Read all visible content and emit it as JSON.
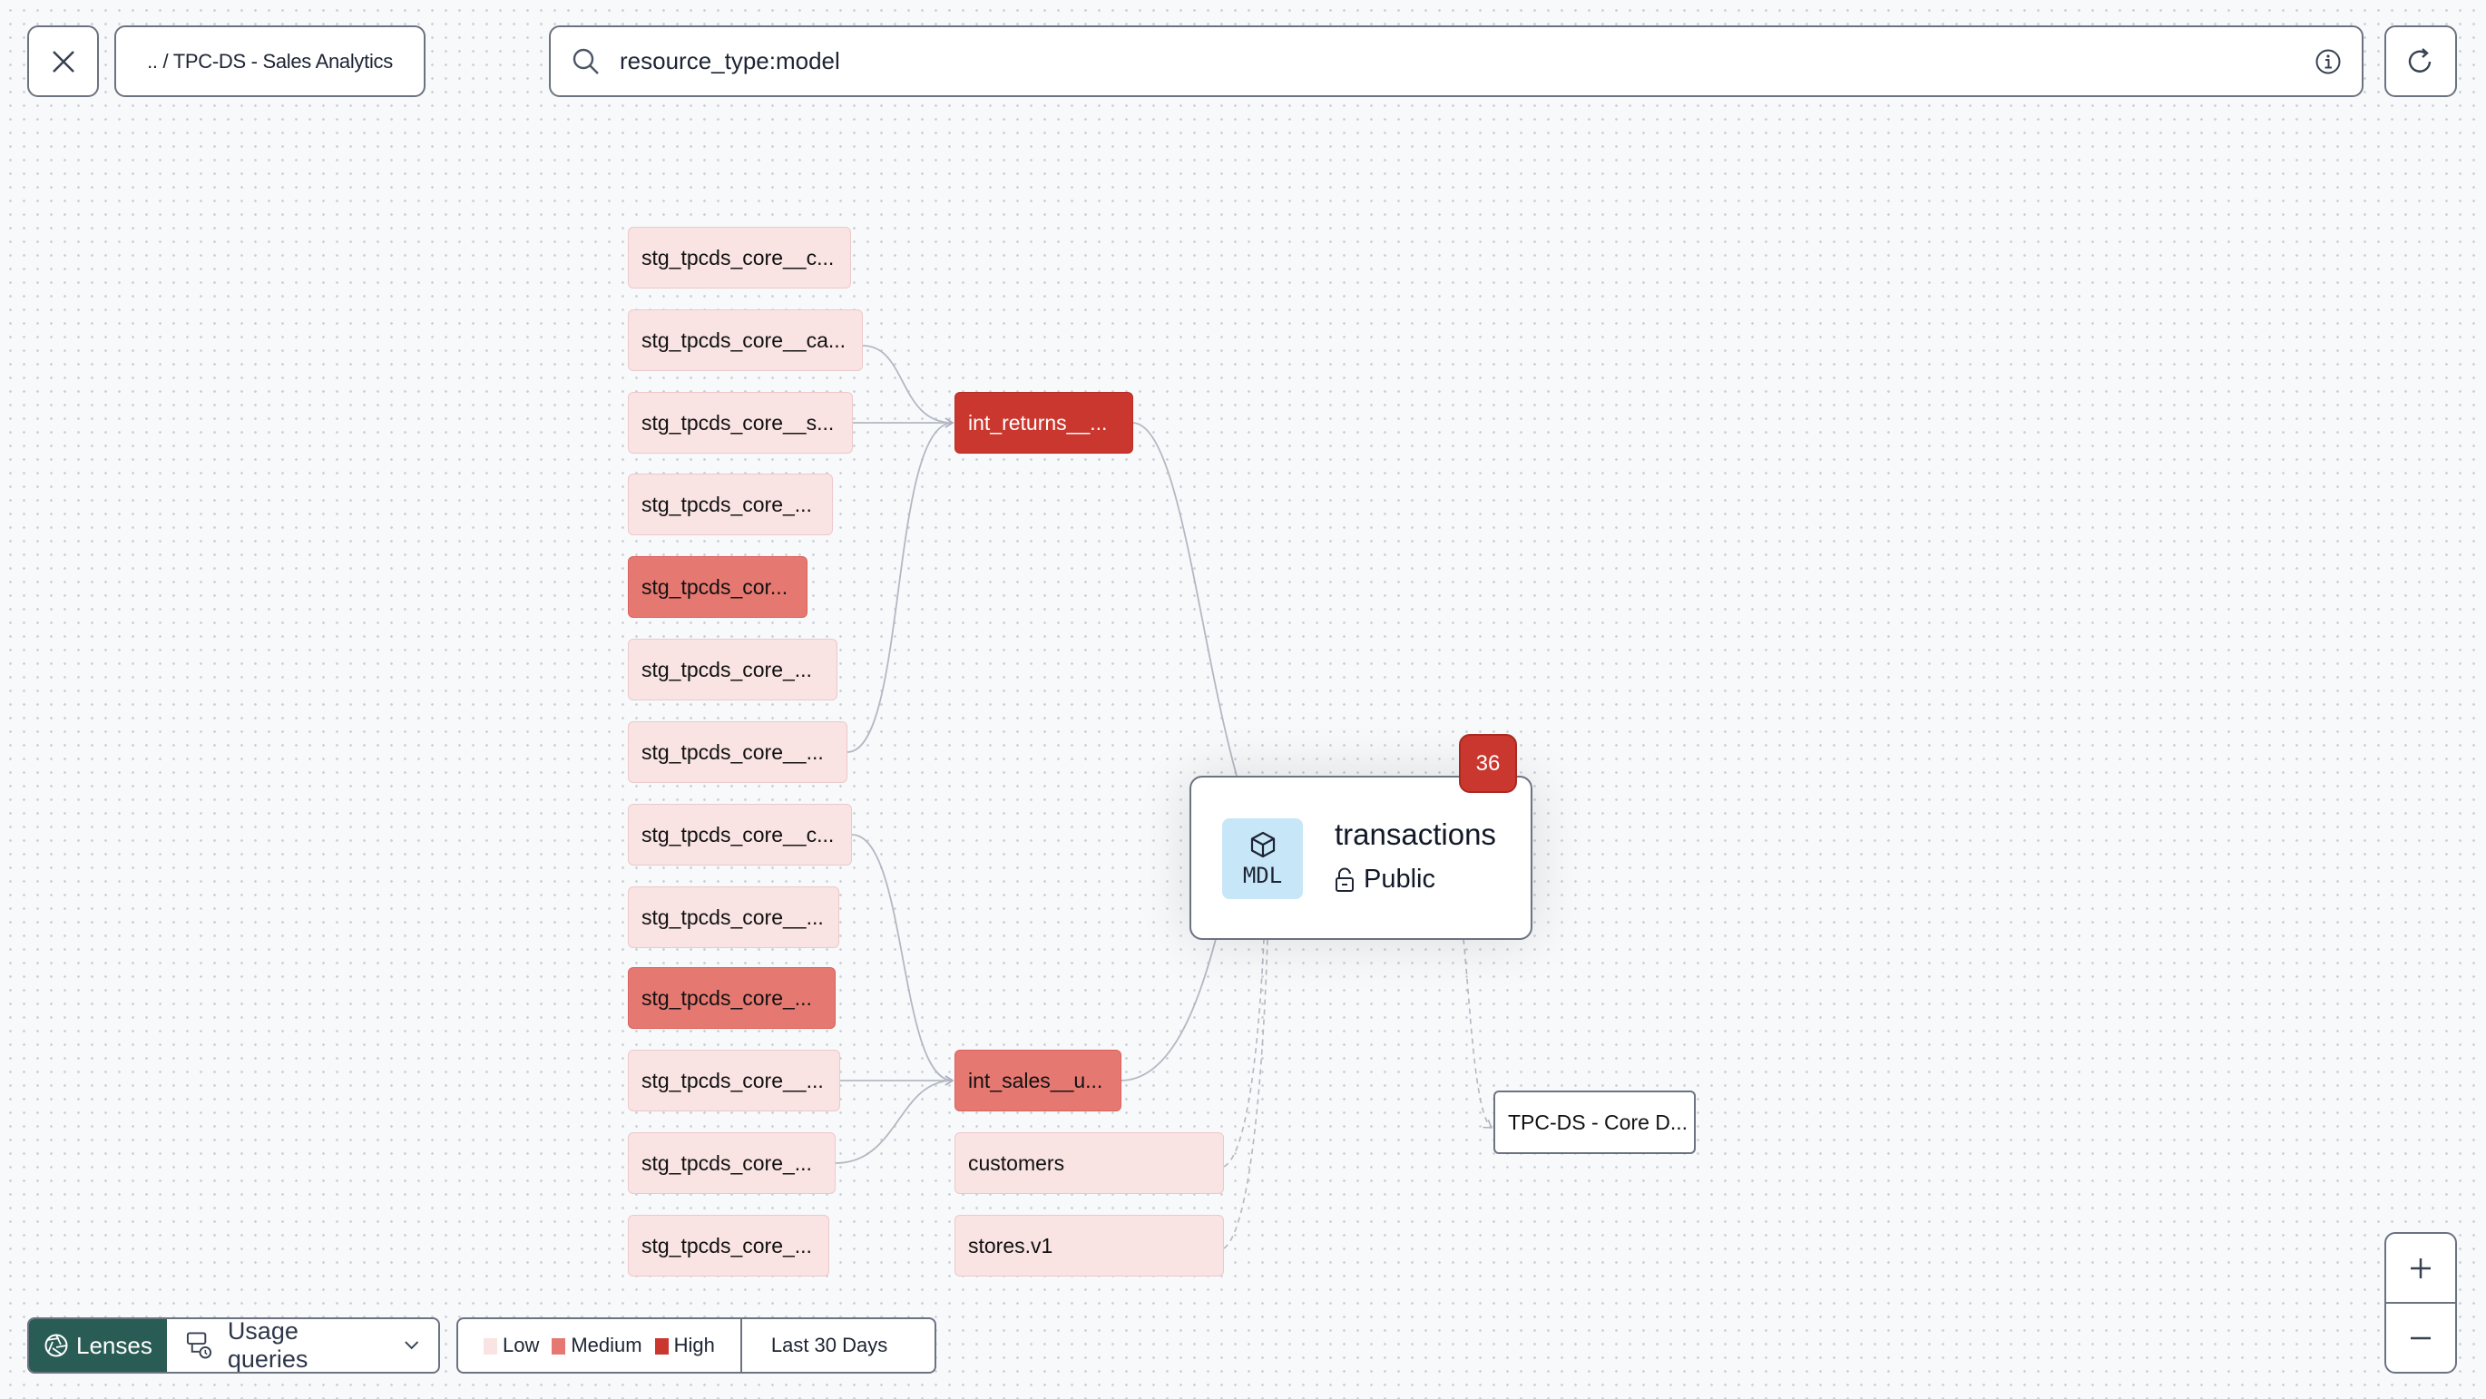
{
  "header": {
    "close_icon": "close-icon",
    "breadcrumb": ".. / TPC-DS - Sales Analytics",
    "search": {
      "value": "resource_type:model",
      "icon": "search-icon",
      "info_icon": "info-icon"
    },
    "refresh_icon": "refresh-icon"
  },
  "graph": {
    "upstream_staging": [
      {
        "label": "stg_tpcds_core__c...",
        "usage": "low"
      },
      {
        "label": "stg_tpcds_core__ca...",
        "usage": "low"
      },
      {
        "label": "stg_tpcds_core__s...",
        "usage": "low"
      },
      {
        "label": "stg_tpcds_core_...",
        "usage": "low"
      },
      {
        "label": "stg_tpcds_cor...",
        "usage": "medium"
      },
      {
        "label": "stg_tpcds_core_...",
        "usage": "low"
      },
      {
        "label": "stg_tpcds_core__...",
        "usage": "low"
      },
      {
        "label": "stg_tpcds_core__c...",
        "usage": "low"
      },
      {
        "label": "stg_tpcds_core__...",
        "usage": "low"
      },
      {
        "label": "stg_tpcds_core_...",
        "usage": "medium"
      },
      {
        "label": "stg_tpcds_core__...",
        "usage": "low"
      },
      {
        "label": "stg_tpcds_core_...",
        "usage": "low"
      },
      {
        "label": "stg_tpcds_core_...",
        "usage": "low"
      }
    ],
    "intermediate": [
      {
        "label": "int_returns__...",
        "usage": "high"
      },
      {
        "label": "int_sales__u...",
        "usage": "medium"
      },
      {
        "label": "customers",
        "usage": "low"
      },
      {
        "label": "stores.v1",
        "usage": "low"
      }
    ],
    "central": {
      "name": "transactions",
      "type_label": "MDL",
      "type_icon": "cube-icon",
      "access": "Public",
      "access_icon": "unlock-icon",
      "usage_count": "36"
    },
    "downstream": [
      {
        "label": "TPC-DS - Core D..."
      }
    ]
  },
  "footer": {
    "lenses_label": "Lenses",
    "lens_select": "Usage queries",
    "legend": [
      {
        "label": "Low",
        "color": "#f9e3e3"
      },
      {
        "label": "Medium",
        "color": "#e67872"
      },
      {
        "label": "High",
        "color": "#c9372f"
      }
    ],
    "period": "Last 30 Days"
  },
  "zoom": {
    "in_label": "+",
    "out_label": "−"
  }
}
